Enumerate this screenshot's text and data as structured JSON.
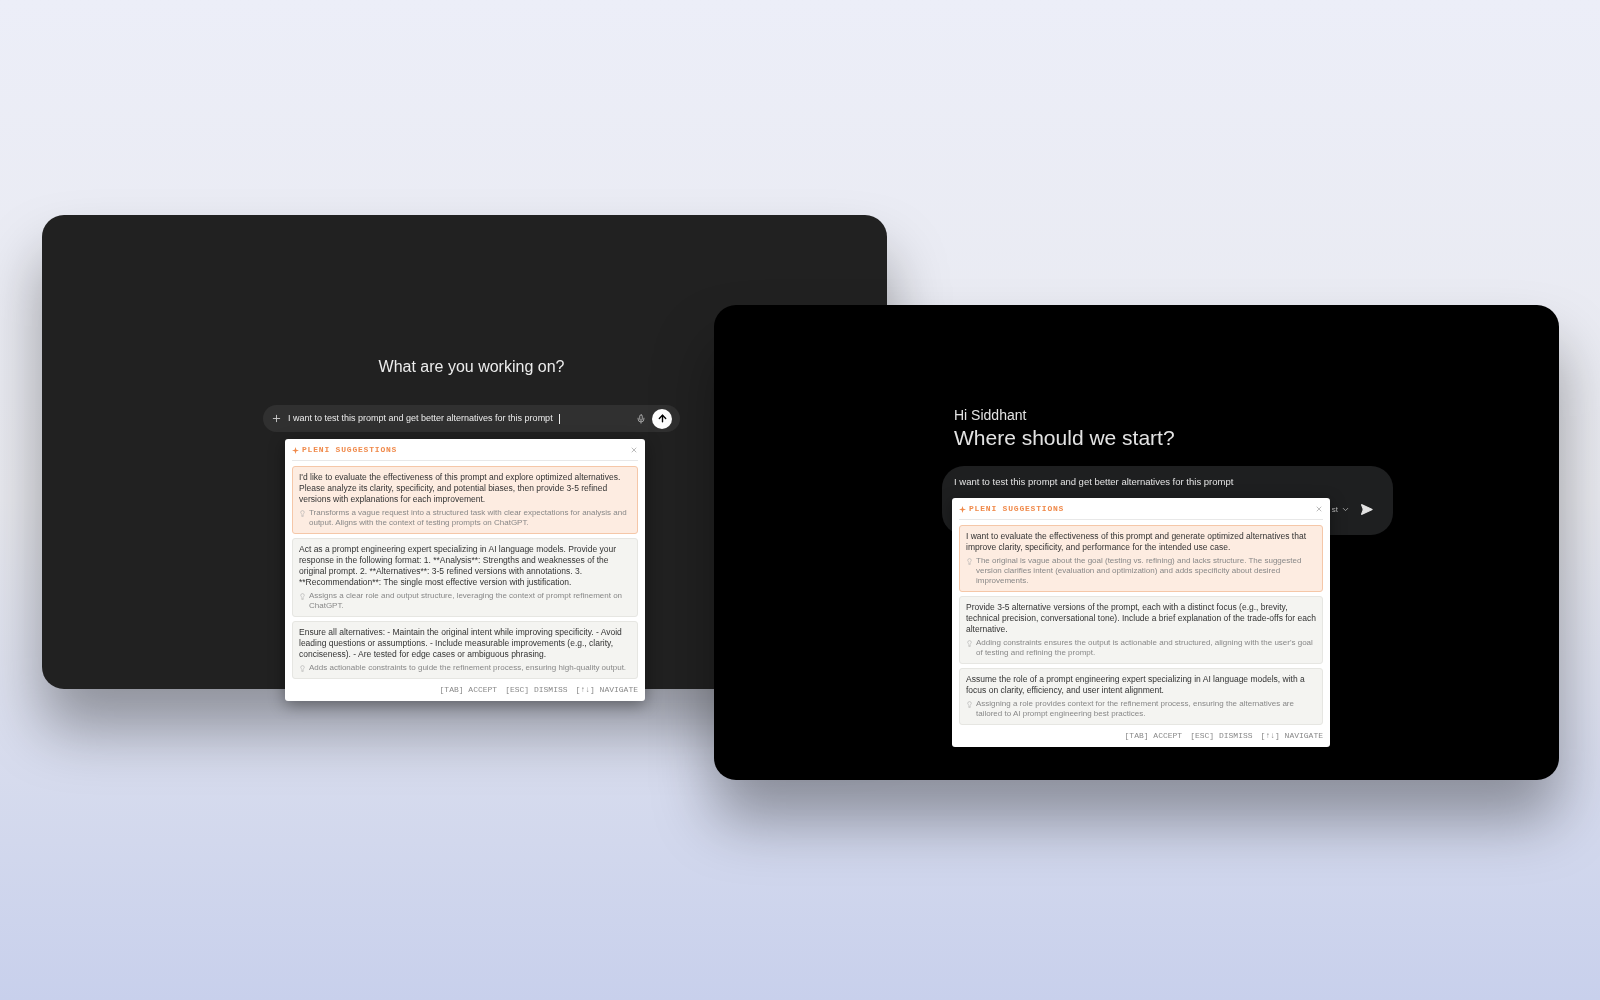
{
  "windows": [
    {
      "kind": "chatgpt",
      "heading": "What are you working on?",
      "input": {
        "value": "I want to test this prompt and get better alternatives for this prompt"
      },
      "suggestions": {
        "title": "PLENI SUGGESTIONS",
        "items": [
          {
            "selected": true,
            "text": "I'd like to evaluate the effectiveness of this prompt and explore optimized alternatives. Please analyze its clarity, specificity, and potential biases, then provide 3-5 refined versions with explanations for each improvement.",
            "hint": "Transforms a vague request into a structured task with clear expectations for analysis and output. Aligns with the context of testing prompts on ChatGPT."
          },
          {
            "selected": false,
            "text": "Act as a prompt engineering expert specializing in AI language models. Provide your response in the following format: 1. **Analysis**: Strengths and weaknesses of the original prompt. 2. **Alternatives**: 3-5 refined versions with annotations. 3. **Recommendation**: The single most effective version with justification.",
            "hint": "Assigns a clear role and output structure, leveraging the context of prompt refinement on ChatGPT."
          },
          {
            "selected": false,
            "text": "Ensure all alternatives: - Maintain the original intent while improving specificity. - Avoid leading questions or assumptions. - Include measurable improvements (e.g., clarity, conciseness). - Are tested for edge cases or ambiguous phrasing.",
            "hint": "Adds actionable constraints to guide the refinement process, ensuring high-quality output."
          }
        ],
        "shortcuts": [
          "[TAB] ACCEPT",
          "[ESC] DISMISS",
          "[↑↓] NAVIGATE"
        ]
      }
    },
    {
      "kind": "gemini",
      "greeting": "Hi Siddhant",
      "heading": "Where should we start?",
      "input": {
        "value": "I want to test this prompt and get better alternatives for this prompt"
      },
      "model_label": "st",
      "suggestions": {
        "title": "PLENI SUGGESTIONS",
        "items": [
          {
            "selected": true,
            "text": "I want to evaluate the effectiveness of this prompt and generate optimized alternatives that improve clarity, specificity, and performance for the intended use case.",
            "hint": "The original is vague about the goal (testing vs. refining) and lacks structure. The suggested version clarifies intent (evaluation and optimization) and adds specificity about desired improvements."
          },
          {
            "selected": false,
            "text": "Provide 3-5 alternative versions of the prompt, each with a distinct focus (e.g., brevity, technical precision, conversational tone). Include a brief explanation of the trade-offs for each alternative.",
            "hint": "Adding constraints ensures the output is actionable and structured, aligning with the user's goal of testing and refining the prompt."
          },
          {
            "selected": false,
            "text": "Assume the role of a prompt engineering expert specializing in AI language models, with a focus on clarity, efficiency, and user intent alignment.",
            "hint": "Assigning a role provides context for the refinement process, ensuring the alternatives are tailored to AI prompt engineering best practices."
          }
        ],
        "shortcuts": [
          "[TAB] ACCEPT",
          "[ESC] DISMISS",
          "[↑↓] NAVIGATE"
        ]
      }
    }
  ]
}
